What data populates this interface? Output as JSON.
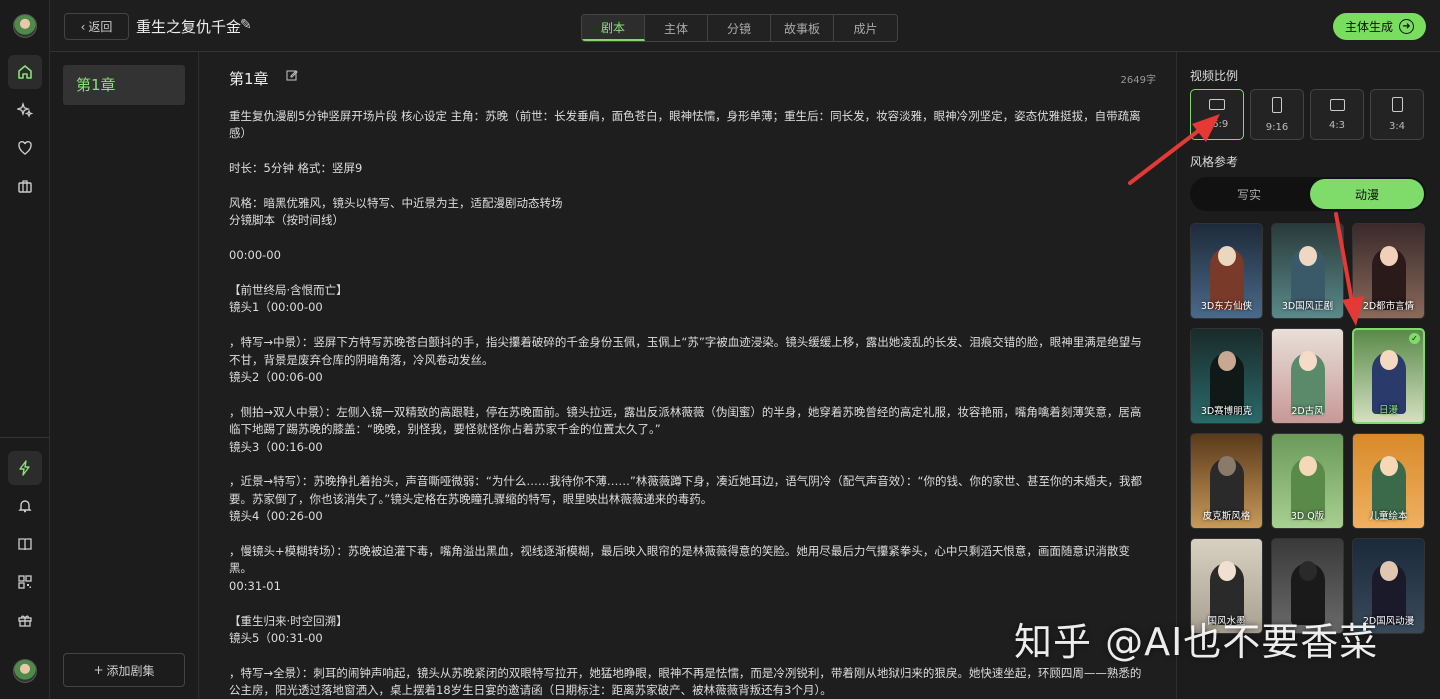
{
  "nav": {
    "back_label": "返回",
    "project_title": "重生之复仇千金",
    "tabs": [
      "剧本",
      "主体",
      "分镜",
      "故事板",
      "成片"
    ],
    "active_tab": "剧本",
    "generate_label": "主体生成"
  },
  "rail": {
    "icons": [
      "home-icon",
      "sparkle-icon",
      "heart-icon",
      "briefcase-icon",
      "lightning-icon",
      "bell-icon",
      "book-icon",
      "qrcode-icon",
      "gift-icon"
    ]
  },
  "chapters": {
    "items": [
      "第1章"
    ],
    "add_label": "添加剧集"
  },
  "editor": {
    "chapter_title": "第1章",
    "word_count": "2649字",
    "lines": [
      "重生复仇漫剧5分钟竖屏开场片段 核心设定 主角：苏晚（前世：长发垂肩，面色苍白，眼神怯懦，身形单薄；重生后：同长发，妆容淡雅，眼神冷冽坚定，姿态优雅挺拔，自带疏离感）",
      "",
      "时长：5分钟 格式：竖屏9",
      "",
      "风格：暗黑优雅风，镜头以特写、中近景为主，适配漫剧动态转场",
      "分镜脚本（按时间线）",
      "",
      "00:00-00",
      "",
      "【前世终局·含恨而亡】",
      "镜头1（00:00-00",
      "",
      "，特写→中景）：竖屏下方特写苏晚苍白颤抖的手，指尖攥着破碎的千金身份玉佩，玉佩上“苏”字被血迹浸染。镜头缓缓上移，露出她凌乱的长发、泪痕交错的脸，眼神里满是绝望与不甘，背景是废弃仓库的阴暗角落，冷风卷动发丝。",
      "镜头2（00:06-00",
      "",
      "，侧拍→双人中景）：左侧入镜一双精致的高跟鞋，停在苏晚面前。镜头拉远，露出反派林薇薇（伪闺蜜）的半身，她穿着苏晚曾经的高定礼服，妆容艳丽，嘴角噙着刻薄笑意，居高临下地踢了踢苏晚的膝盖：“晚晚，别怪我，要怪就怪你占着苏家千金的位置太久了。”",
      "镜头3（00:16-00",
      "",
      "，近景→特写）：苏晚挣扎着抬头，声音嘶哑微弱：“为什么……我待你不薄……”林薇薇蹲下身，凑近她耳边，语气阴冷（配气声音效）：“你的钱、你的家世、甚至你的未婚夫，我都要。苏家倒了，你也该消失了。”镜头定格在苏晚瞳孔骤缩的特写，眼里映出林薇薇递来的毒药。",
      "镜头4（00:26-00",
      "",
      "，慢镜头+模糊转场）：苏晚被迫灌下毒，嘴角溢出黑血，视线逐渐模糊，最后映入眼帘的是林薇薇得意的笑脸。她用尽最后力气攥紧拳头，心中只剩滔天恨意，画面随意识消散变黑。",
      "00:31-01",
      "",
      "【重生归来·时空回溯】",
      "镜头5（00:31-00",
      "",
      "，特写→全景）：刺耳的闹钟声响起，镜头从苏晚紧闭的双眼特写拉开，她猛地睁眼，眼神不再是怯懦，而是冷冽锐利，带着刚从地狱归来的狠戾。她快速坐起，环顾四周——熟悉的公主房，阳光透过落地窗洒入，桌上摆着18岁生日宴的邀请函（日期标注：距离苏家破产、被林薇薇背叛还有3个月）。"
    ]
  },
  "panel": {
    "ratio_label": "视频比例",
    "ratios": [
      "16:9",
      "9:16",
      "4:3",
      "3:4"
    ],
    "active_ratio": "16:9",
    "style_label": "风格参考",
    "style_modes": [
      "写实",
      "动漫"
    ],
    "active_mode": "动漫",
    "styles": [
      "3D东方仙侠",
      "3D国风正剧",
      "2D都市言情",
      "3D赛博朋克",
      "2D古风",
      "日漫",
      "皮克斯风格",
      "3D Q版",
      "儿童绘本",
      "国风水墨",
      "",
      "2D国风动漫"
    ],
    "active_style": "日漫"
  },
  "watermark": "知乎 @AI也不要香菜",
  "colors": {
    "accent": "#7fdc6a",
    "arrow": "#e53935"
  }
}
